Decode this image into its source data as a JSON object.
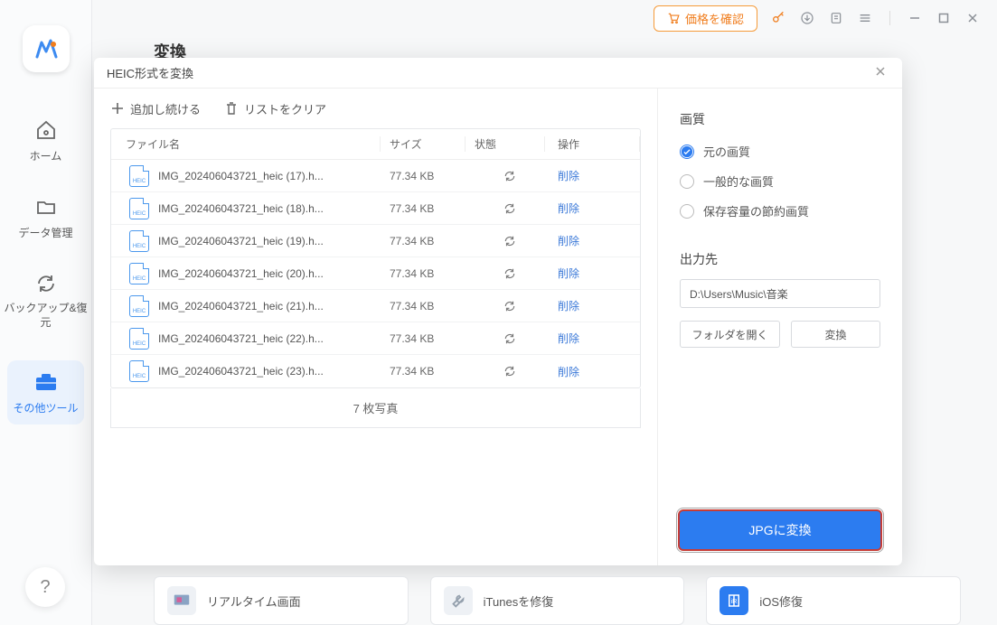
{
  "window": {
    "price_button": "価格を確認"
  },
  "page": {
    "heading": "変換"
  },
  "sidebar": {
    "items": [
      {
        "label": "ホーム"
      },
      {
        "label": "データ管理"
      },
      {
        "label": "バックアップ&復元"
      },
      {
        "label": "その他ツール"
      }
    ]
  },
  "modal": {
    "title": "HEIC形式を変換",
    "toolbar": {
      "add_more": "追加し続ける",
      "clear_list": "リストをクリア"
    },
    "columns": {
      "name": "ファイル名",
      "size": "サイズ",
      "status": "状態",
      "action": "操作"
    },
    "delete_label": "削除",
    "files": [
      {
        "name": "IMG_202406043721_heic (17).h...",
        "size": "77.34 KB"
      },
      {
        "name": "IMG_202406043721_heic (18).h...",
        "size": "77.34 KB"
      },
      {
        "name": "IMG_202406043721_heic (19).h...",
        "size": "77.34 KB"
      },
      {
        "name": "IMG_202406043721_heic (20).h...",
        "size": "77.34 KB"
      },
      {
        "name": "IMG_202406043721_heic (21).h...",
        "size": "77.34 KB"
      },
      {
        "name": "IMG_202406043721_heic (22).h...",
        "size": "77.34 KB"
      },
      {
        "name": "IMG_202406043721_heic (23).h...",
        "size": "77.34 KB"
      }
    ],
    "count_text": "7 枚写真"
  },
  "options": {
    "quality_heading": "画質",
    "quality": {
      "original": "元の画質",
      "normal": "一般的な画質",
      "lowsize": "保存容量の節約画質"
    },
    "output_heading": "出力先",
    "output_path": "D:\\Users\\Music\\音楽",
    "open_folder": "フォルダを開く",
    "convert_small": "変換",
    "primary": "JPGに変換"
  },
  "tiles": {
    "realtime": "リアルタイム画面",
    "itunes": "iTunesを修復",
    "ios": "iOS修復"
  },
  "heic_badge_text": "HEIC"
}
